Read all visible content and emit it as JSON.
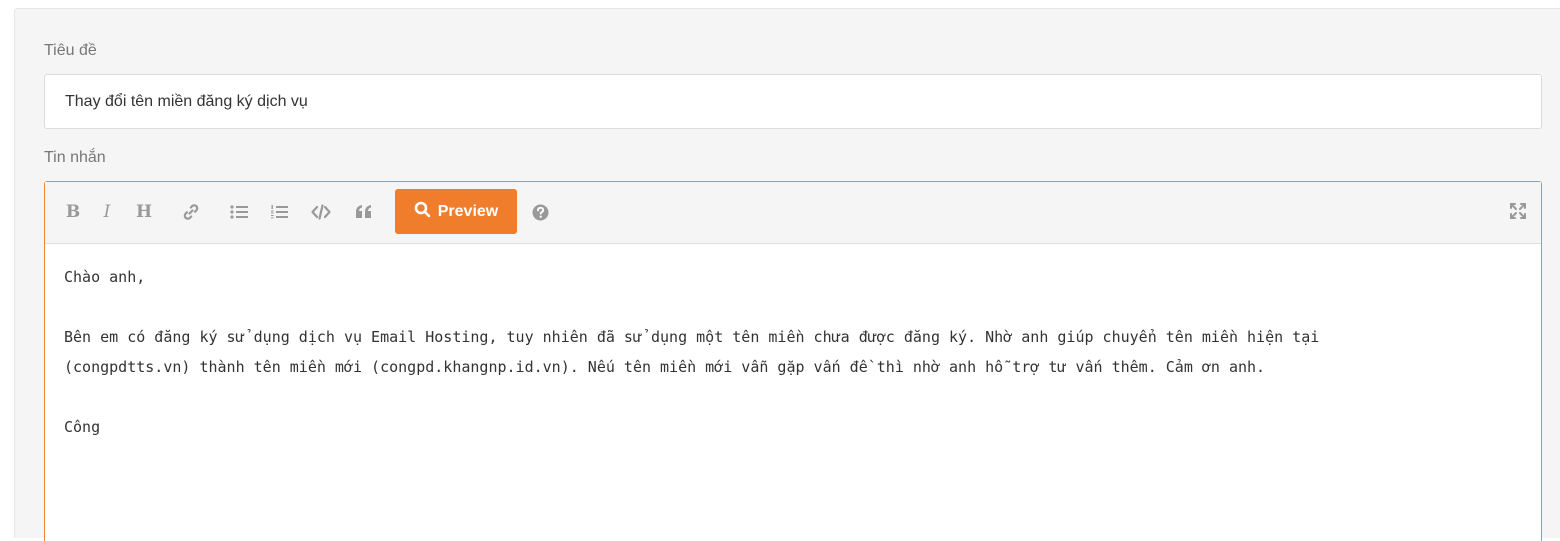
{
  "form": {
    "subject_label": "Tiêu đề",
    "subject_value": "Thay đổi tên miền đăng ký dịch vụ",
    "message_label": "Tin nhắn"
  },
  "toolbar": {
    "bold_label": "B",
    "italic_label": "I",
    "heading_label": "H",
    "preview_label": "Preview"
  },
  "icons": {
    "bold": "bold-icon",
    "italic": "italic-icon",
    "heading": "heading-icon",
    "link": "link-icon",
    "unordered_list": "unordered-list-icon",
    "ordered_list": "ordered-list-icon",
    "code": "code-icon",
    "quote": "quote-icon",
    "preview": "search-icon",
    "help": "help-circle-icon",
    "fullscreen": "fullscreen-icon"
  },
  "colors": {
    "accent": "#ef7d2c",
    "editor_border": "#f0883a",
    "spellcheck_underline": "#e0401c"
  },
  "message": {
    "greeting": "Chào anh,",
    "body_line1": "Bên em có đăng ký sử dụng dịch vụ Email Hosting, tuy nhiên đã sử dụng một tên miền chưa được đăng ký. Nhờ anh giúp chuyển tên miền hiện tại",
    "body_line2": "(congpdtts.vn) thành tên miền mới (congpd.khangnp.id.vn). Nếu tên miền mới vẫn gặp vấn đề thì nhờ anh hỗ trợ tư vấn thêm. Cảm ơn anh.",
    "signature": "Công"
  }
}
